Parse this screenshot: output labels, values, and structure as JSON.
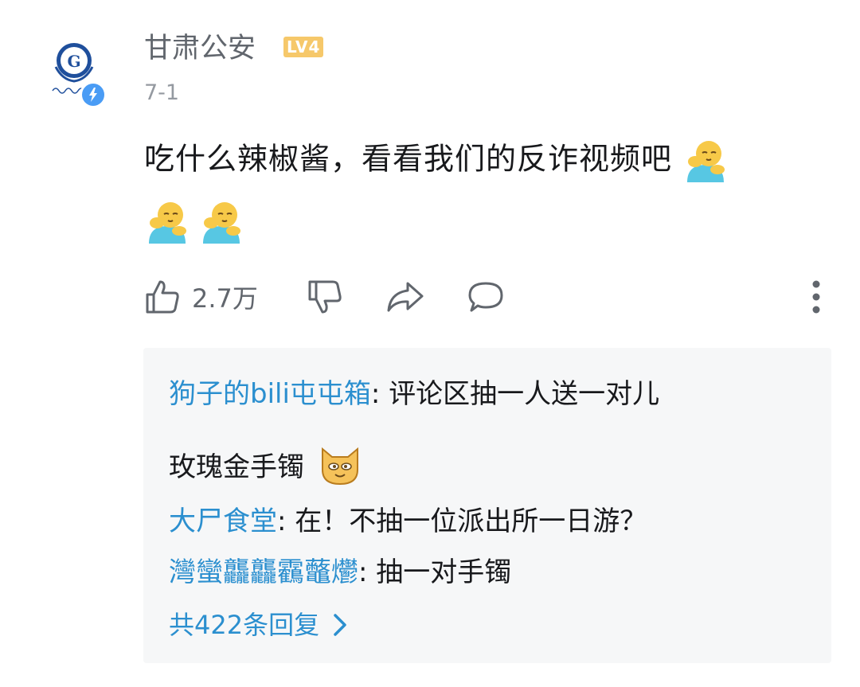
{
  "comment": {
    "username": "甘肃公安",
    "level": "LV4",
    "timestamp": "7-1",
    "text": "吃什么辣椒酱，看看我们的反诈视频吧",
    "emojis": [
      "hug-emoji",
      "hug-emoji",
      "hug-emoji"
    ]
  },
  "actions": {
    "like_count": "2.7万",
    "icons": [
      "thumbs-up-icon",
      "thumbs-down-icon",
      "share-icon",
      "comment-icon",
      "more-icon"
    ]
  },
  "replies": [
    {
      "user": "狗子的bili屯屯箱",
      "text_line1": ": 评论区抽一人送一对儿",
      "text_line2": "玫瑰金手镯",
      "emoji": "cat-emoji"
    },
    {
      "user": "大尸食堂",
      "text": ": 在！不抽一位派出所一日游？"
    },
    {
      "user": "灣蠻龘龘靏虌爩",
      "text": ": 抽一对手镯"
    }
  ],
  "view_replies": "共422条回复",
  "colors": {
    "link_blue": "#2b8fcf",
    "level_badge": "#f6c86a",
    "verified_badge": "#4a9cf5",
    "reply_box_bg": "#f6f7f8",
    "muted_text": "#61666d"
  }
}
